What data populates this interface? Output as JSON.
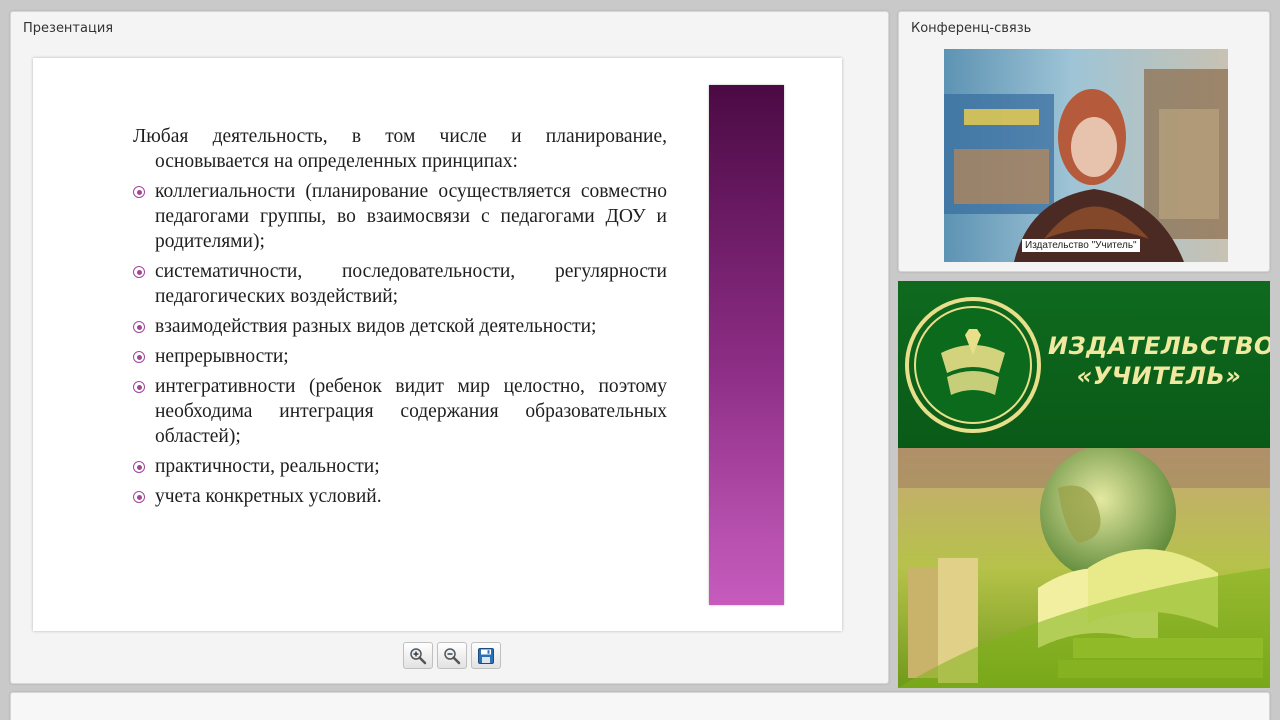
{
  "presentation": {
    "title": "Презентация",
    "slide": {
      "intro": "Любая деятельность, в том числе и планирование, основывается на определенных принципах:",
      "bullets": [
        "коллегиальности (планирование осуществляется совместно педагогами группы, во взаимосвязи с педагогами ДОУ и родителями);",
        "систематичности, последовательности, регулярности педагогических воздействий;",
        "взаимодействия разных видов детской деятельности;",
        "непрерывности;",
        "интегративности (ребенок видит мир целостно, поэтому необходима интеграция содержания образовательных областей);",
        "практичности, реальности;",
        "учета конкретных условий."
      ]
    },
    "toolbar": {
      "zoom_in_icon": "zoom-in-icon",
      "zoom_out_icon": "zoom-out-icon",
      "save_icon": "save-icon"
    }
  },
  "conference": {
    "title": "Конференц-связь",
    "video_caption": "Издательство \"Учитель\""
  },
  "banner": {
    "logo_line1": "ИЗДАТЕЛЬСТВО",
    "logo_line2": "«УЧИТЕЛЬ»"
  },
  "colors": {
    "accent_purple": "#8e2e86",
    "banner_green": "#0f6a1f",
    "logo_gold": "#f2e9a0"
  }
}
